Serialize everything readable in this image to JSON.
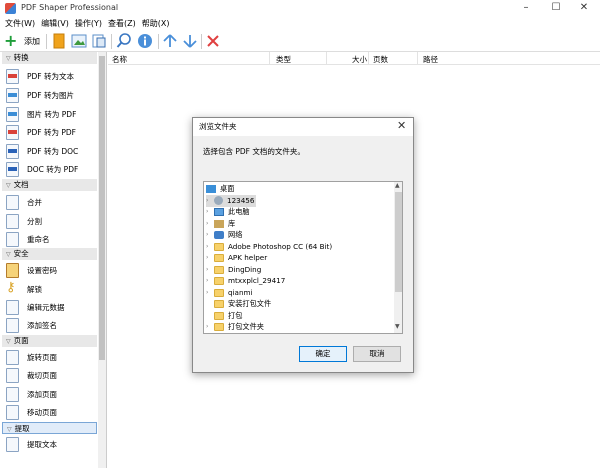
{
  "window": {
    "title": "PDF Shaper Professional",
    "min": "–",
    "max": "☐",
    "close": "✕"
  },
  "menu": [
    "文件(W)",
    "编辑(V)",
    "操作(Y)",
    "查看(Z)",
    "帮助(X)"
  ],
  "toolbar": {
    "add_label": "添加"
  },
  "sidebar": {
    "categories": {
      "convert": "转换",
      "document": "文档",
      "security": "安全",
      "page": "页面",
      "extract": "提取"
    },
    "convert_items": [
      "PDF 转为文本",
      "PDF 转为图片",
      "图片 转为 PDF",
      "PDF 转为 PDF",
      "PDF 转为 DOC",
      "DOC 转为 PDF"
    ],
    "document_items": [
      "合并",
      "分割",
      "重命名"
    ],
    "security_items": [
      "设置密码",
      "解锁",
      "编辑元数据",
      "添加签名"
    ],
    "page_items": [
      "旋转页面",
      "裁切页面",
      "添加页面",
      "移动页面"
    ],
    "extract_items": [
      "提取文本"
    ]
  },
  "list": {
    "columns": [
      "名称",
      "类型",
      "大小",
      "页数",
      "路径"
    ]
  },
  "dialog": {
    "title": "浏览文件夹",
    "close": "✕",
    "prompt": "选择包含 PDF 文档的文件夹。",
    "tree": [
      "桌面",
      "123456",
      "此电脑",
      "库",
      "网络",
      "Adobe Photoshop CC (64 Bit)",
      "APK helper",
      "DingDing",
      "mtxxplcl_29417",
      "qianmi",
      "安装打包文件",
      "打包",
      "打包文件夹"
    ],
    "ok": "确定",
    "cancel": "取消"
  }
}
